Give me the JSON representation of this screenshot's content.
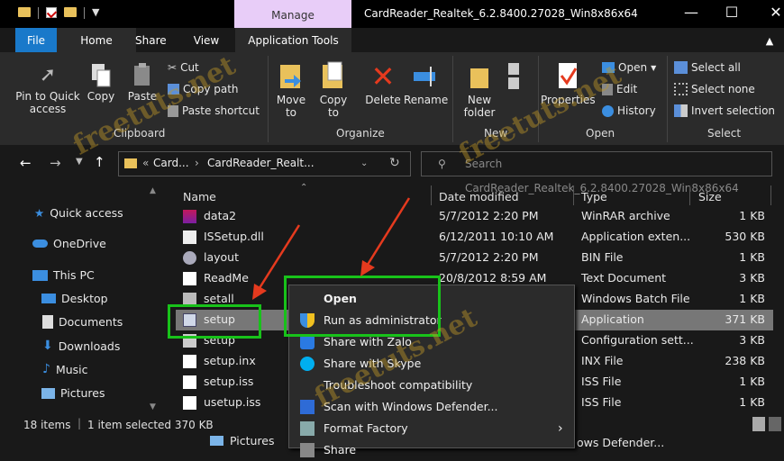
{
  "window": {
    "context_tab": "Manage",
    "title": "CardReader_Realtek_6.2.8400.27028_Win8x86x64",
    "minimize": "—",
    "maximize": "☐",
    "close": "✕"
  },
  "tabs": {
    "file": "File",
    "home": "Home",
    "share": "Share",
    "view": "View",
    "app_tools": "Application Tools"
  },
  "ribbon": {
    "pin": "Pin to Quick\naccess",
    "copy": "Copy",
    "paste": "Paste",
    "cut": "Cut",
    "copy_path": "Copy path",
    "paste_shortcut": "Paste shortcut",
    "clipboard": "Clipboard",
    "move_to": "Move\nto",
    "copy_to": "Copy\nto",
    "delete": "Delete",
    "rename": "Rename",
    "organize": "Organize",
    "new_folder": "New\nfolder",
    "new": "New",
    "properties": "Properties",
    "open": "Open",
    "edit": "Edit",
    "history": "History",
    "open_group": "Open",
    "select_all": "Select all",
    "select_none": "Select none",
    "invert_selection": "Invert selection",
    "select_group": "Select"
  },
  "address": {
    "crumb_prefix": "«",
    "crumb1": "Card...",
    "crumb2": "CardReader_Realt...",
    "search_placeholder": "Search CardReader_Realtek_6.2.8400.27028_Win8x86x64"
  },
  "nav": {
    "quick_access": "Quick access",
    "onedrive": "OneDrive",
    "this_pc": "This PC",
    "desktop": "Desktop",
    "documents": "Documents",
    "downloads": "Downloads",
    "music": "Music",
    "pictures": "Pictures"
  },
  "columns": {
    "name": "Name",
    "date": "Date modified",
    "type": "Type",
    "size": "Size"
  },
  "files": [
    {
      "name": "data2",
      "date": "5/7/2012 2:20 PM",
      "type": "WinRAR archive",
      "size": "1 KB"
    },
    {
      "name": "ISSetup.dll",
      "date": "6/12/2011 10:10 AM",
      "type": "Application exten...",
      "size": "530 KB"
    },
    {
      "name": "layout",
      "date": "5/7/2012 2:20 PM",
      "type": "BIN File",
      "size": "1 KB"
    },
    {
      "name": "ReadMe",
      "date": "20/8/2012 8:59 AM",
      "type": "Text Document",
      "size": "3 KB"
    },
    {
      "name": "setall",
      "date": "",
      "type": "Windows Batch File",
      "size": "1 KB"
    },
    {
      "name": "setup",
      "date": "",
      "type": "Application",
      "size": "371 KB"
    },
    {
      "name": "setup",
      "date": "",
      "type": "Configuration sett...",
      "size": "3 KB"
    },
    {
      "name": "setup.inx",
      "date": "",
      "type": "INX File",
      "size": "238 KB"
    },
    {
      "name": "setup.iss",
      "date": "",
      "type": "ISS File",
      "size": "1 KB"
    },
    {
      "name": "usetup.iss",
      "date": "",
      "type": "ISS File",
      "size": "1 KB"
    }
  ],
  "status": {
    "items": "18 items",
    "selected": "1 item selected  370 KB"
  },
  "context_menu": {
    "open": "Open",
    "run_admin": "Run as administrator",
    "share_zalo": "Share with Zalo",
    "share_skype": "Share with Skype",
    "troubleshoot": "Troubleshoot compatibility",
    "scan_defender": "Scan with Windows Defender...",
    "format_factory": "Format Factory",
    "share": "Share"
  },
  "background_peek": {
    "pictures": "Pictures",
    "defender": "ows Defender..."
  },
  "watermark": "freetuts.net",
  "colors": {
    "accent": "#1979ca",
    "highlight_box": "#18c21a",
    "arrow": "#e53a1e",
    "manage_tab": "#e8cdf8"
  }
}
